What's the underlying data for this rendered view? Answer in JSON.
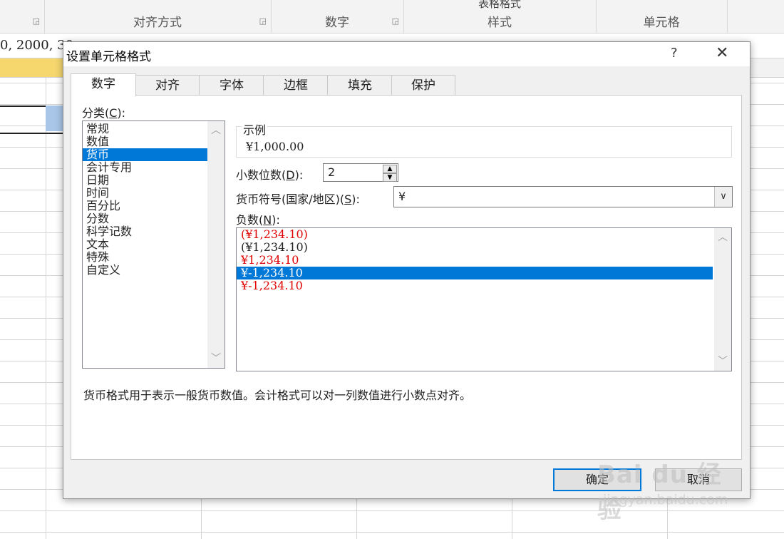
{
  "ribbon": {
    "top_label": "表格格式",
    "groups": [
      "对齐方式",
      "数字",
      "样式",
      "单元格"
    ]
  },
  "formula_bar": {
    "text": "0, 2000, 30"
  },
  "dialog": {
    "title": "设置单元格格式",
    "help_glyph": "?",
    "close_glyph": "✕",
    "tabs": [
      "数字",
      "对齐",
      "字体",
      "边框",
      "填充",
      "保护"
    ],
    "active_tab": "数字",
    "category": {
      "label_prefix": "分类(",
      "label_key": "C",
      "label_suffix": "):",
      "items": [
        "常规",
        "数值",
        "货币",
        "会计专用",
        "日期",
        "时间",
        "百分比",
        "分数",
        "科学记数",
        "文本",
        "特殊",
        "自定义"
      ],
      "selected": "货币"
    },
    "sample": {
      "legend": "示例",
      "value": "¥1,000.00"
    },
    "decimal": {
      "label_prefix": "小数位数(",
      "label_key": "D",
      "label_suffix": "):",
      "value": "2"
    },
    "currency_symbol": {
      "label_prefix": "货币符号(国家/地区)(",
      "label_key": "S",
      "label_suffix": "):",
      "value": "¥"
    },
    "negative": {
      "label_prefix": "负数(",
      "label_key": "N",
      "label_suffix": "):",
      "items": [
        {
          "text": "(¥1,234.10)",
          "color": "red"
        },
        {
          "text": "(¥1,234.10)",
          "color": "black"
        },
        {
          "text": "¥1,234.10",
          "color": "red"
        },
        {
          "text": "¥-1,234.10",
          "color": "black"
        },
        {
          "text": "¥-1,234.10",
          "color": "red"
        }
      ],
      "selected_index": 3
    },
    "description": "货币格式用于表示一般货币数值。会计格式可以对一列数值进行小数点对齐。",
    "buttons": {
      "ok": "确定",
      "cancel": "取消"
    }
  },
  "watermark": {
    "logo": "Bai du 经验",
    "sub": "jingyan.baidu.com"
  },
  "colors": {
    "selection": "#0078d7",
    "negative_red": "#e00000",
    "header_highlight": "#f5d76e"
  }
}
